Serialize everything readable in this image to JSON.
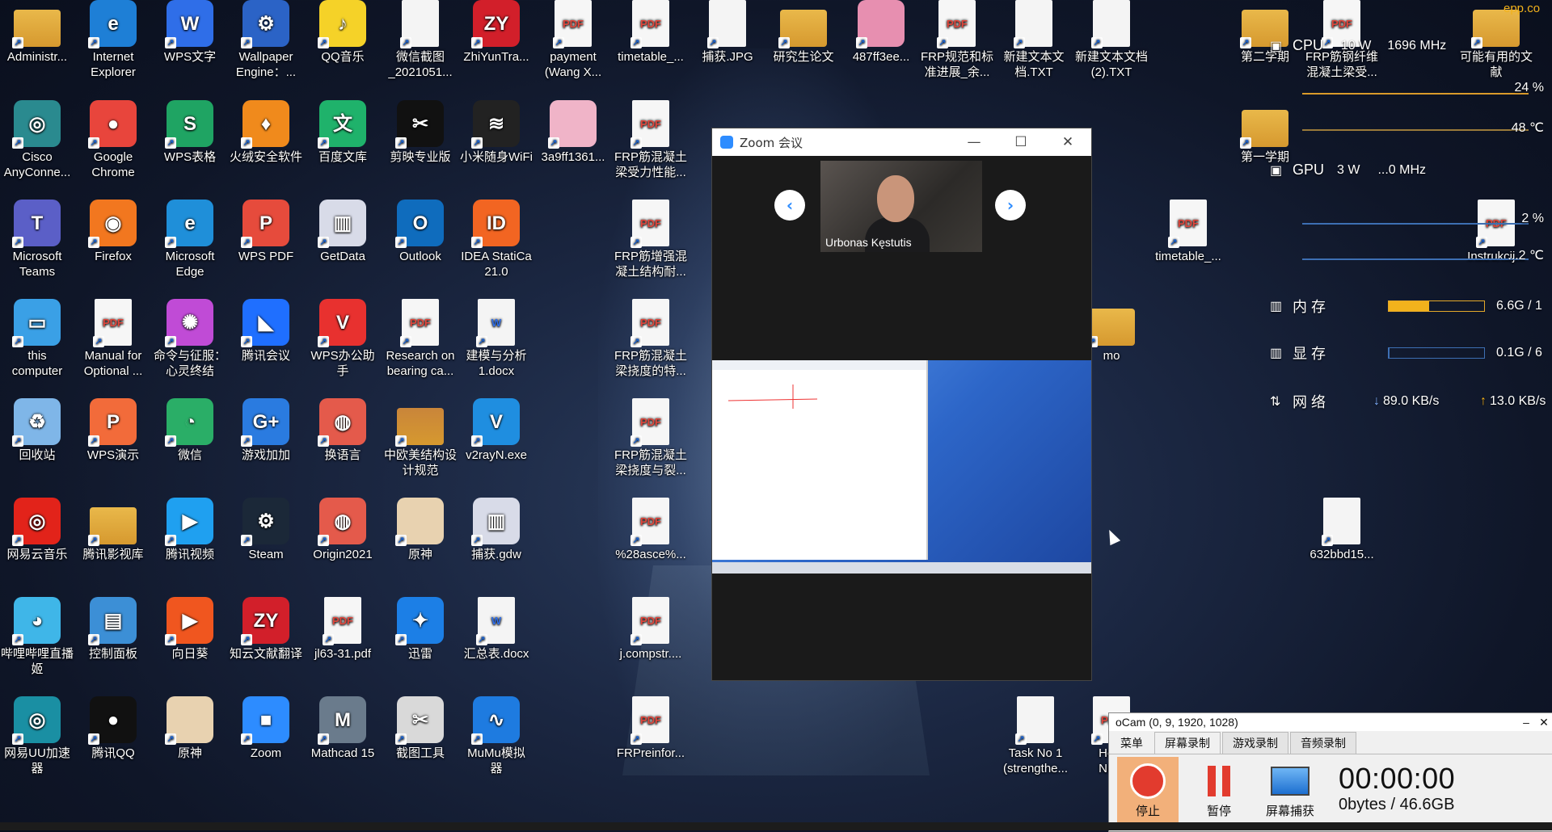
{
  "desktop": {
    "icons": [
      {
        "label": "Administr...",
        "icon": "user-folder-icon",
        "color": "#e9b84a",
        "kind": "folder"
      },
      {
        "label": "Internet\nExplorer",
        "icon": "internet-explorer-icon",
        "color": "#1e7fd6",
        "kind": "app",
        "glyph": "e"
      },
      {
        "label": "WPS文字",
        "icon": "wps-writer-icon",
        "color": "#2f6ee8",
        "kind": "app",
        "glyph": "W"
      },
      {
        "label": "Wallpaper\nEngine：...",
        "icon": "wallpaper-engine-icon",
        "color": "#2b63c6",
        "kind": "app",
        "glyph": "⚙"
      },
      {
        "label": "QQ音乐",
        "icon": "qq-music-icon",
        "color": "#f5d228",
        "kind": "app",
        "glyph": "♪"
      },
      {
        "label": "微信截图\n_2021051...",
        "icon": "image-file-icon",
        "color": "#e9d36b",
        "kind": "doc",
        "glyph": ""
      },
      {
        "label": "ZhiYunTra...",
        "icon": "zhiyun-icon",
        "color": "#d21f2a",
        "kind": "app",
        "glyph": "ZY"
      },
      {
        "label": "payment\n(Wang X...",
        "icon": "pdf-icon",
        "color": "#e0463c",
        "kind": "pdf",
        "glyph": "PDF"
      },
      {
        "label": "timetable_...",
        "icon": "pdf-icon",
        "color": "#e0463c",
        "kind": "pdf",
        "glyph": "PDF"
      },
      {
        "label": "捕获.JPG",
        "icon": "image-file-icon",
        "color": "#dcdcdc",
        "kind": "doc",
        "glyph": ""
      },
      {
        "label": "研究生论文",
        "icon": "folder-icon",
        "color": "#e9b84a",
        "kind": "folder"
      },
      {
        "label": "487ff3ee...",
        "icon": "image-file-icon",
        "color": "#e78fb0",
        "kind": "app",
        "glyph": ""
      },
      {
        "label": "FRP规范和标\n准进展_余...",
        "icon": "pdf-icon",
        "color": "#e0463c",
        "kind": "pdf",
        "glyph": "PDF"
      },
      {
        "label": "新建文本文\n档.TXT",
        "icon": "text-file-icon",
        "color": "#f4f4f4",
        "kind": "doc",
        "glyph": ""
      },
      {
        "label": "新建文本文档\n(2).TXT",
        "icon": "text-file-icon",
        "color": "#f4f4f4",
        "kind": "doc",
        "glyph": ""
      },
      {
        "label": "第二学期",
        "icon": "folder-icon",
        "color": "#e9b84a",
        "kind": "folder"
      },
      {
        "label": "FRP筋钢纤维\n混凝土梁受...",
        "icon": "pdf-icon",
        "color": "#e0463c",
        "kind": "pdf",
        "glyph": "PDF"
      },
      {
        "label": "可能有用的文\n献",
        "icon": "folder-icon",
        "color": "#e9b84a",
        "kind": "folder"
      },
      {
        "label": "Cisco\nAnyConne...",
        "icon": "cisco-anyconnect-icon",
        "color": "#2a8a8f",
        "kind": "app",
        "glyph": "◎"
      },
      {
        "label": "Google\nChrome",
        "icon": "chrome-icon",
        "color": "#e8453c",
        "kind": "app",
        "glyph": "●"
      },
      {
        "label": "WPS表格",
        "icon": "wps-sheet-icon",
        "color": "#1fa463",
        "kind": "app",
        "glyph": "S"
      },
      {
        "label": "火绒安全软件",
        "icon": "huorong-icon",
        "color": "#f08a1c",
        "kind": "app",
        "glyph": "♦"
      },
      {
        "label": "百度文库",
        "icon": "baidu-wenku-icon",
        "color": "#1fb26b",
        "kind": "app",
        "glyph": "文"
      },
      {
        "label": "剪映专业版",
        "icon": "capcut-icon",
        "color": "#111111",
        "kind": "app",
        "glyph": "✂"
      },
      {
        "label": "小米随身WiFi",
        "icon": "wifi-icon",
        "color": "#222222",
        "kind": "app",
        "glyph": "≋"
      },
      {
        "label": "3a9ff1361...",
        "icon": "image-file-icon",
        "color": "#f0b4c8",
        "kind": "app",
        "glyph": ""
      },
      {
        "label": "FRP筋混凝土\n梁受力性能...",
        "icon": "pdf-icon",
        "color": "#e0463c",
        "kind": "pdf",
        "glyph": "PDF"
      },
      {
        "label": "第一学期",
        "icon": "folder-icon",
        "color": "#e9b84a",
        "kind": "folder"
      },
      {
        "label": "Microsoft\nTeams",
        "icon": "teams-icon",
        "color": "#5b5fc7",
        "kind": "app",
        "glyph": "T"
      },
      {
        "label": "Firefox",
        "icon": "firefox-icon",
        "color": "#f2771f",
        "kind": "app",
        "glyph": "◉"
      },
      {
        "label": "Microsoft\nEdge",
        "icon": "edge-icon",
        "color": "#1f8fd9",
        "kind": "app",
        "glyph": "e"
      },
      {
        "label": "WPS PDF",
        "icon": "wps-pdf-icon",
        "color": "#e64b3c",
        "kind": "app",
        "glyph": "P"
      },
      {
        "label": "GetData",
        "icon": "getdata-icon",
        "color": "#d8dbe8",
        "kind": "app",
        "glyph": "▥"
      },
      {
        "label": "Outlook",
        "icon": "outlook-icon",
        "color": "#0f6cbd",
        "kind": "app",
        "glyph": "O"
      },
      {
        "label": "IDEA StatiCa\n21.0",
        "icon": "idea-statica-icon",
        "color": "#f26522",
        "kind": "app",
        "glyph": "ID"
      },
      {
        "label": "FRP筋增强混\n凝土结构耐...",
        "icon": "pdf-icon",
        "color": "#e0463c",
        "kind": "pdf",
        "glyph": "PDF"
      },
      {
        "label": "timetable_...",
        "icon": "pdf-icon",
        "color": "#e0463c",
        "kind": "pdf",
        "glyph": "PDF"
      },
      {
        "label": "Instrukcij...",
        "icon": "pdf-icon",
        "color": "#e0463c",
        "kind": "pdf",
        "glyph": "PDF"
      },
      {
        "label": "this\ncomputer",
        "icon": "computer-icon",
        "color": "#3aa0e6",
        "kind": "app",
        "glyph": "▭"
      },
      {
        "label": "Manual for\nOptional ...",
        "icon": "pdf-icon",
        "color": "#e0463c",
        "kind": "pdf",
        "glyph": "PDF"
      },
      {
        "label": "命令与征服：\n心灵终结",
        "icon": "game-icon",
        "color": "#c04bd6",
        "kind": "app",
        "glyph": "✺"
      },
      {
        "label": "腾讯会议",
        "icon": "tencent-meeting-icon",
        "color": "#1f6fff",
        "kind": "app",
        "glyph": "◣"
      },
      {
        "label": "WPS办公助\n手",
        "icon": "wps-assistant-icon",
        "color": "#e8312f",
        "kind": "app",
        "glyph": "V"
      },
      {
        "label": "Research on\nbearing ca...",
        "icon": "pdf-icon",
        "color": "#e0463c",
        "kind": "pdf",
        "glyph": "PDF"
      },
      {
        "label": "建模与分析\n1.docx",
        "icon": "docx-icon",
        "color": "#2f6ee8",
        "kind": "doc",
        "glyph": "W"
      },
      {
        "label": "FRP筋混凝土\n梁挠度的特...",
        "icon": "pdf-icon",
        "color": "#e0463c",
        "kind": "pdf",
        "glyph": "PDF"
      },
      {
        "label": "mo",
        "icon": "folder-icon",
        "color": "#e9b84a",
        "kind": "folder"
      },
      {
        "label": "回收站",
        "icon": "recycle-bin-icon",
        "color": "#7fb6e8",
        "kind": "app",
        "glyph": "♻"
      },
      {
        "label": "WPS演示",
        "icon": "wps-presentation-icon",
        "color": "#f26b3a",
        "kind": "app",
        "glyph": "P"
      },
      {
        "label": "微信",
        "icon": "wechat-icon",
        "color": "#2aae67",
        "kind": "app",
        "glyph": "◔"
      },
      {
        "label": "游戏加加",
        "icon": "game-plus-icon",
        "color": "#2a7be0",
        "kind": "app",
        "glyph": "G+"
      },
      {
        "label": "换语言",
        "icon": "origin-icon",
        "color": "#e45a4b",
        "kind": "app",
        "glyph": "◍"
      },
      {
        "label": "中欧美结构设\n计规范",
        "icon": "archive-icon",
        "color": "#c9853a",
        "kind": "folder"
      },
      {
        "label": "v2rayN.exe",
        "icon": "v2rayn-icon",
        "color": "#1f8ee0",
        "kind": "app",
        "glyph": "V"
      },
      {
        "label": "FRP筋混凝土\n梁挠度与裂...",
        "icon": "pdf-icon",
        "color": "#e0463c",
        "kind": "pdf",
        "glyph": "PDF"
      },
      {
        "label": "网易云音乐",
        "icon": "netease-music-icon",
        "color": "#e2231a",
        "kind": "app",
        "glyph": "◎"
      },
      {
        "label": "腾讯影视库",
        "icon": "video-folder-icon",
        "color": "#e9b84a",
        "kind": "folder"
      },
      {
        "label": "腾讯视频",
        "icon": "tencent-video-icon",
        "color": "#1fa0f0",
        "kind": "app",
        "glyph": "▶"
      },
      {
        "label": "Steam",
        "icon": "steam-icon",
        "color": "#1b2838",
        "kind": "app",
        "glyph": "⚙"
      },
      {
        "label": "Origin2021",
        "icon": "origin-icon",
        "color": "#e45a4b",
        "kind": "app",
        "glyph": "◍"
      },
      {
        "label": "原神",
        "icon": "genshin-icon",
        "color": "#e8d2b0",
        "kind": "app",
        "glyph": ""
      },
      {
        "label": "捕获.gdw",
        "icon": "getdata-icon",
        "color": "#d8dbe8",
        "kind": "app",
        "glyph": "▥"
      },
      {
        "label": "%28asce%...",
        "icon": "pdf-icon",
        "color": "#e0463c",
        "kind": "pdf",
        "glyph": "PDF"
      },
      {
        "label": "632bbd15...",
        "icon": "image-file-icon",
        "color": "#f4f4f4",
        "kind": "doc",
        "glyph": ""
      },
      {
        "label": "哔哩哔哩直播\n姬",
        "icon": "bilibili-live-icon",
        "color": "#3fb6e8",
        "kind": "app",
        "glyph": "◕"
      },
      {
        "label": "控制面板",
        "icon": "control-panel-icon",
        "color": "#3c8fd6",
        "kind": "app",
        "glyph": "▤"
      },
      {
        "label": "向日葵",
        "icon": "sunlogin-icon",
        "color": "#f0561f",
        "kind": "app",
        "glyph": "▶"
      },
      {
        "label": "知云文献翻译",
        "icon": "zhiyun-icon",
        "color": "#d21f2a",
        "kind": "app",
        "glyph": "ZY"
      },
      {
        "label": "jl63-31.pdf",
        "icon": "pdf-icon",
        "color": "#e0463c",
        "kind": "pdf",
        "glyph": "PDF"
      },
      {
        "label": "迅雷",
        "icon": "xunlei-icon",
        "color": "#1c7fe6",
        "kind": "app",
        "glyph": "✦"
      },
      {
        "label": "汇总表.docx",
        "icon": "docx-icon",
        "color": "#2f6ee8",
        "kind": "doc",
        "glyph": "W"
      },
      {
        "label": "j.compstr....",
        "icon": "pdf-icon",
        "color": "#e0463c",
        "kind": "pdf",
        "glyph": "PDF"
      },
      {
        "label": "网易UU加速\n器",
        "icon": "uu-accelerator-icon",
        "color": "#1a8fa3",
        "kind": "app",
        "glyph": "◎"
      },
      {
        "label": "腾讯QQ",
        "icon": "qq-icon",
        "color": "#111111",
        "kind": "app",
        "glyph": "●"
      },
      {
        "label": "原神",
        "icon": "genshin-icon",
        "color": "#e8d2b0",
        "kind": "app",
        "glyph": ""
      },
      {
        "label": "Zoom",
        "icon": "zoom-icon",
        "color": "#2d8cff",
        "kind": "app",
        "glyph": "■"
      },
      {
        "label": "Mathcad 15",
        "icon": "mathcad-icon",
        "color": "#6a7b8c",
        "kind": "app",
        "glyph": "M"
      },
      {
        "label": "截图工具",
        "icon": "snipping-tool-icon",
        "color": "#d9d9d9",
        "kind": "app",
        "glyph": "✂"
      },
      {
        "label": "MuMu模拟\n器",
        "icon": "mumu-icon",
        "color": "#1e7be0",
        "kind": "app",
        "glyph": "∿"
      },
      {
        "label": "FRPreinfor...",
        "icon": "pdf-icon",
        "color": "#e0463c",
        "kind": "pdf",
        "glyph": "PDF"
      },
      {
        "label": "Task No 1\n(strengthe...",
        "icon": "image-file-icon",
        "color": "#f4f4f4",
        "kind": "doc",
        "glyph": ""
      },
      {
        "label": "Hom\nNum",
        "icon": "pdf-icon",
        "color": "#e0463c",
        "kind": "pdf",
        "glyph": "PDF"
      }
    ]
  },
  "zoom": {
    "title": "Zoom 会议",
    "participant_name": "Urbonas Kęstutis",
    "prev_label": "‹",
    "next_label": "›",
    "minimize": "—",
    "maximize": "☐",
    "close": "✕"
  },
  "sysmon": {
    "cpu_label": "CPU",
    "cpu_power": "10 W",
    "cpu_freq": "1696 MHz",
    "cpu_usage": "24 %",
    "cpu_temp": "48 ℃",
    "gpu_label": "GPU",
    "gpu_power": "3 W",
    "gpu_freq": "...0 MHz",
    "gpu_usage": "2 %",
    "gpu_temp": "...2 ℃",
    "mem_label": "内 存",
    "mem_value": "6.6G / 1",
    "mem_fraction": 0.42,
    "vram_label": "显 存",
    "vram_value": "0.1G / 6",
    "vram_fraction": 0.01,
    "net_label": "网 络",
    "net_down": "89.0 KB/s",
    "net_up": "13.0 KB/s",
    "accent_color": "#f2b21c",
    "top_right_text": "epp.co"
  },
  "ocam": {
    "title": "oCam (0, 9, 1920, 1028)",
    "tabs": [
      "菜单",
      "屏幕录制",
      "游戏录制",
      "音频录制"
    ],
    "stop_label": "停止",
    "pause_label": "暂停",
    "capture_label": "屏幕捕获",
    "timer": "00:00:00",
    "size": "0bytes / 46.6GB",
    "close": "✕",
    "minimize": "–"
  }
}
